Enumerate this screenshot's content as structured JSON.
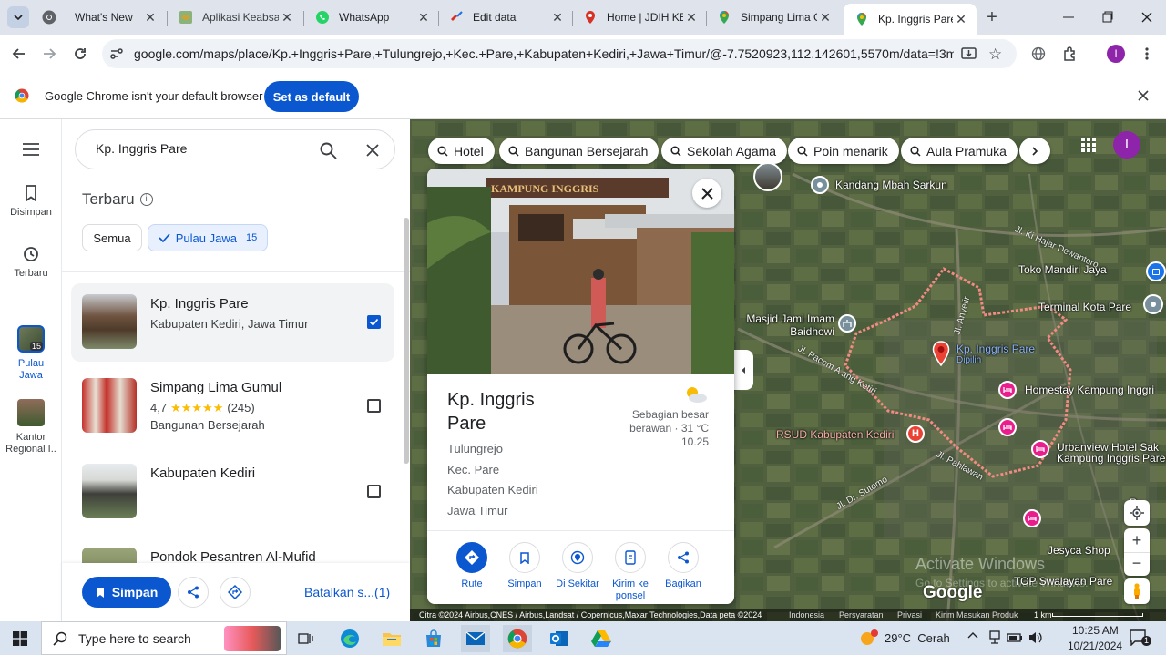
{
  "tabs": [
    {
      "title": "What's New",
      "icon": "chrome-icon"
    },
    {
      "title": "Aplikasi Keabsah",
      "icon": "garuda-icon"
    },
    {
      "title": "WhatsApp",
      "icon": "whatsapp-icon"
    },
    {
      "title": "Edit data",
      "icon": "edit-icon"
    },
    {
      "title": "Home | JDIH KE",
      "icon": "jdih-icon"
    },
    {
      "title": "Simpang Lima G",
      "icon": "maps-pin-icon"
    },
    {
      "title": "Kp. Inggris Pare",
      "icon": "maps-pin-icon"
    }
  ],
  "address_bar": {
    "url": "google.com/maps/place/Kp.+Inggris+Pare,+Tulungrejo,+Kec.+Pare,+Kabupaten+Kediri,+Jawa+Timur/@-7.7520923,112.142601,5570m/data=!3m1!1e3!4..."
  },
  "profile_initial": "I",
  "infobar": {
    "message": "Google Chrome isn't your default browser",
    "button": "Set as default"
  },
  "rail": {
    "saved": "Disimpan",
    "recent": "Terbaru",
    "java_badge": "15",
    "java": "Pulau Jawa",
    "regional": "Kantor Regional I.."
  },
  "sidebar": {
    "search_value": "Kp. Inggris Pare",
    "section_title": "Terbaru",
    "filters": {
      "all": "Semua",
      "java": "Pulau Jawa",
      "java_count": "15"
    },
    "places": [
      {
        "name": "Kp. Inggris Pare",
        "line1": "Kabupaten Kediri, Jawa Timur",
        "checked": true
      },
      {
        "name": "Simpang Lima Gumul",
        "rating": "4,7",
        "stars": "★★★★★",
        "reviews": "(245)",
        "line1": "Bangunan Bersejarah",
        "checked": false
      },
      {
        "name": "Kabupaten Kediri",
        "checked": false
      },
      {
        "name": "Pondok Pesantren Al-Mufid"
      }
    ],
    "save_button": "Simpan",
    "cancel_link": "Batalkan s...(1)"
  },
  "map": {
    "chips": [
      "Hotel",
      "Bangunan Bersejarah",
      "Sekolah Agama",
      "Poin menarik",
      "Aula Pramuka"
    ],
    "labels": {
      "kandang": "Kandang Mbah Sarkun",
      "toko": "Toko Mandiri Jaya",
      "terminal": "Terminal Kota Pare",
      "masjid": "Masjid Jami Imam Baidhowi",
      "kp_inggris": "Kp. Inggris Pare",
      "dipilih": "Dipilih",
      "homestay": "Homestay Kampung Inggri",
      "rsud": "RSUD Kabupaten Kediri",
      "urbanview1": "Urbanview Hotel Sak",
      "urbanview2": "Kampung Inggris Pare",
      "jesyca": "Jesyca Shop",
      "top": "TOP Swalayan Pare",
      "p_edge": "P"
    },
    "roads": [
      "Jl. Ki Hajar Dewantoro",
      "Jl. Anyelir",
      "Jl. Pacem A ang Ketiri",
      "Jl. Pahlawan",
      "Jl. Dr. Sutomo"
    ],
    "watermark1": "Activate Windows",
    "watermark2": "Go to Settings to activate Windows.",
    "google": "Google",
    "footer": {
      "credits": "Citra ©2024 Airbus,CNES / Airbus,Landsat / Copernicus,Maxar Technologies,Data peta ©2024",
      "country": "Indonesia",
      "terms": "Persyaratan",
      "privacy": "Privasi",
      "feedback": "Kirim Masukan Produk",
      "scale": "1 km"
    }
  },
  "card": {
    "photo_sign": "KAMPUNG INGGRIS",
    "title": "Kp. Inggris Pare",
    "address": [
      "Tulungrejo",
      "Kec. Pare",
      "Kabupaten Kediri",
      "Jawa Timur"
    ],
    "weather": "Sebagian besar berawan · 31 °C",
    "time": "10.25",
    "actions": [
      "Rute",
      "Simpan",
      "Di Sekitar",
      "Kirim ke ponsel",
      "Bagikan"
    ]
  },
  "taskbar": {
    "search_placeholder": "Type here to search",
    "weather": "29°C  Cerah",
    "time": "10:25 AM",
    "date": "10/21/2024",
    "notif_count": "1"
  },
  "colors": {
    "accent": "#0b57d0",
    "route": "#f28b82",
    "map_base": "#4a5a3e",
    "hotel_pin": "#e91e8c"
  }
}
